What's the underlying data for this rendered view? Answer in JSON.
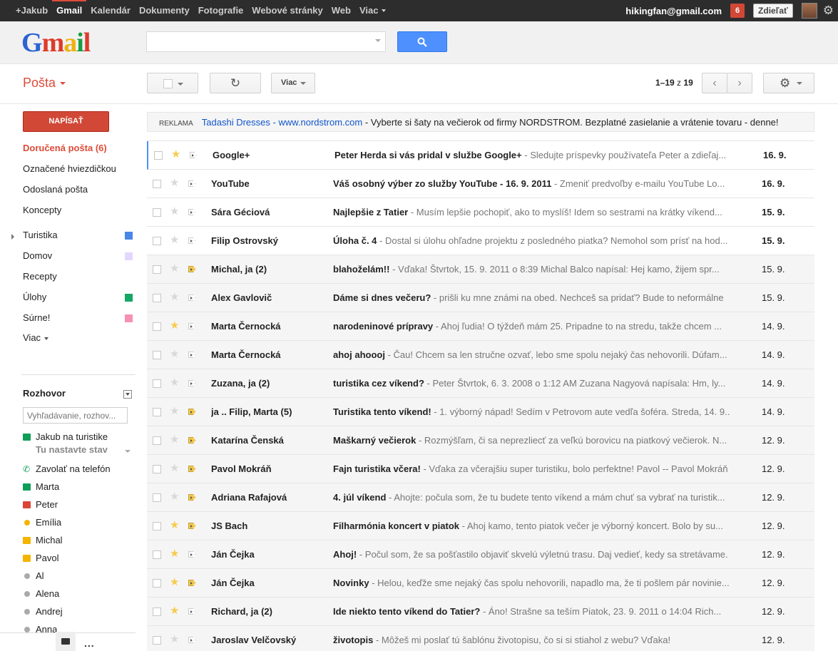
{
  "topbar": {
    "links": [
      "+Jakub",
      "Gmail",
      "Kalendár",
      "Dokumenty",
      "Fotografie",
      "Webové stránky",
      "Web",
      "Viac"
    ],
    "email": "hikingfan@gmail.com",
    "notifications": "6",
    "share_label": "Zdieľať"
  },
  "header": {
    "logo": "Gmail",
    "search_value": ""
  },
  "toolbar": {
    "mail_label": "Pošta",
    "more_label": "Viac",
    "pager_range": "1–19",
    "pager_of": "z",
    "pager_total": "19"
  },
  "sidebar": {
    "compose_label": "NAPÍSAŤ",
    "items": [
      {
        "label": "Doručená pošta (6)",
        "selected": true
      },
      {
        "label": "Označené hviezdičkou"
      },
      {
        "label": "Odoslaná pošta"
      },
      {
        "label": "Koncepty"
      },
      {
        "label": "Turistika",
        "color": "#4986e7"
      },
      {
        "label": "Domov",
        "color": "#e3d7ff"
      },
      {
        "label": "Recepty"
      },
      {
        "label": "Úlohy",
        "color": "#16a765"
      },
      {
        "label": "Súrne!",
        "color": "#f691b2"
      },
      {
        "label": "Viac"
      }
    ]
  },
  "chat": {
    "title": "Rozhovor",
    "search_placeholder": "Vyhľadávanie, rozhov...",
    "me": "Jakub na turistike",
    "status_line": "Tu nastavte stav",
    "call": "Zavolať na telefón",
    "contacts": [
      {
        "name": "Marta",
        "state": "video-green"
      },
      {
        "name": "Peter",
        "state": "video-red"
      },
      {
        "name": "Emília",
        "state": "away"
      },
      {
        "name": "Michal",
        "state": "video-orange"
      },
      {
        "name": "Pavol",
        "state": "video-orange"
      },
      {
        "name": "Al",
        "state": "offline"
      },
      {
        "name": "Alena",
        "state": "offline"
      },
      {
        "name": "Andrej",
        "state": "offline"
      },
      {
        "name": "Anna",
        "state": "offline"
      }
    ],
    "more": "..."
  },
  "ad": {
    "tag": "REKLAMA",
    "link": "Tadashi Dresses - www.nordstrom.com",
    "text": " - Vyberte si šaty na večierok od firmy NORDSTROM. Bezplatné zasielanie a vrátenie tovaru - denne!"
  },
  "emails": [
    {
      "from": "Google+",
      "subject": "Peter Herda si vás pridal v službe Google+",
      "snippet": " - Sledujte príspevky používateľa Peter a zdieľaj...",
      "date": "16. 9.",
      "unread": true,
      "starred": true,
      "important": false
    },
    {
      "from": "YouTube",
      "subject": "Váš osobný výber zo služby YouTube - 16. 9. 2011",
      "snippet": " - Zmeniť predvoľby e-mailu YouTube Lo...",
      "date": "16. 9.",
      "unread": true,
      "starred": false,
      "important": false
    },
    {
      "from": "Sára Géciová",
      "subject": "Najlepšie z Tatier",
      "snippet": " - Musím lepšie pochopiť, ako to myslíš! Idem so sestrami na krátky víkend...",
      "date": "15. 9.",
      "unread": true,
      "starred": false,
      "important": false
    },
    {
      "from": "Filip Ostrovský",
      "subject": "Úloha č. 4",
      "snippet": " - Dostal si úlohu ohľadne projektu z posledného piatka? Nemohol som prísť na hod...",
      "date": "15. 9.",
      "unread": true,
      "starred": false,
      "important": false
    },
    {
      "from": "Michal, ja (2)",
      "subject": "blahoželám!!",
      "snippet": " - Vďaka! Štvrtok, 15. 9. 2011 o 8:39 Michal Balco napísal: Hej kamo, žijem spr...",
      "date": "15. 9.",
      "unread": false,
      "starred": false,
      "important": true
    },
    {
      "from": "Alex Gavlovič",
      "subject": "Dáme si dnes večeru?",
      "snippet": " - prišli ku mne známi na obed. Nechceš sa pridať? Bude to neformálne",
      "date": "15. 9.",
      "unread": false,
      "starred": false,
      "important": false
    },
    {
      "from": "Marta Černocká",
      "subject": "narodeninové prípravy",
      "snippet": " - Ahoj ľudia! O týždeň mám 25. Pripadne to na stredu, takže chcem ...",
      "date": "14. 9.",
      "unread": false,
      "starred": true,
      "important": false
    },
    {
      "from": "Marta Černocká",
      "subject": "ahoj ahoooj",
      "snippet": " - Čau! Chcem sa len stručne ozvať, lebo sme spolu nejaký čas nehovorili. Dúfam...",
      "date": "14. 9.",
      "unread": false,
      "starred": false,
      "important": false
    },
    {
      "from": "Zuzana, ja (2)",
      "subject": "turistika cez víkend?",
      "snippet": " - Peter Štvrtok, 6. 3. 2008 o 1:12 AM Zuzana Nagyová napísala: Hm, ly...",
      "date": "14. 9.",
      "unread": false,
      "starred": false,
      "important": false
    },
    {
      "from": "ja .. Filip, Marta (5)",
      "subject": "Turistika tento víkend!",
      "snippet": " - 1. výborný nápad! Sedím v Petrovom aute vedľa šoféra. Streda, 14. 9...",
      "date": "14. 9.",
      "unread": false,
      "starred": false,
      "important": true
    },
    {
      "from": "Katarína Čenská",
      "subject": "Maškarný večierok",
      "snippet": " - Rozmýšľam, či sa neprezliecť za veľkú borovicu na piatkový večierok. N...",
      "date": "12. 9.",
      "unread": false,
      "starred": false,
      "important": true
    },
    {
      "from": "Pavol Mokráň",
      "subject": "Fajn turistika včera!",
      "snippet": " - Vďaka za včerajšiu super turistiku, bolo perfektne! Pavol -- Pavol Mokráň",
      "date": "12. 9.",
      "unread": false,
      "starred": false,
      "important": true
    },
    {
      "from": "Adriana Rafajová",
      "subject": "4. júl víkend",
      "snippet": " - Ahojte: počula som, že tu budete tento víkend a mám chuť sa vybrať na turistik...",
      "date": "12. 9.",
      "unread": false,
      "starred": false,
      "important": true
    },
    {
      "from": "JS Bach",
      "subject": "Filharmónia koncert v piatok",
      "snippet": " - Ahoj kamo, tento piatok večer je výborný koncert. Bolo by su...",
      "date": "12. 9.",
      "unread": false,
      "starred": true,
      "important": true
    },
    {
      "from": "Ján Čejka",
      "subject": "Ahoj!",
      "snippet": " - Počul som, že sa pošťastilo objaviť skvelú výletnú trasu. Daj vedieť, kedy sa stretávame.",
      "date": "12. 9.",
      "unread": false,
      "starred": true,
      "important": false
    },
    {
      "from": "Ján Čejka",
      "subject": "Novinky",
      "snippet": " - Helou, keďže sme nejaký čas spolu nehovorili, napadlo ma, že ti pošlem pár novinie...",
      "date": "12. 9.",
      "unread": false,
      "starred": true,
      "important": true
    },
    {
      "from": "Richard, ja (2)",
      "subject": "Ide niekto tento víkend do Tatier?",
      "snippet": " - Áno! Strašne sa teším Piatok, 23. 9. 2011 o 14:04 Rich...",
      "date": "12. 9.",
      "unread": false,
      "starred": true,
      "important": false
    },
    {
      "from": "Jaroslav Velčovský",
      "subject": "životopis",
      "snippet": " - Môžeš mi poslať tú šablónu životopisu, čo si si stiahol z webu? Vďaka!",
      "date": "12. 9.",
      "unread": false,
      "starred": false,
      "important": false
    }
  ]
}
